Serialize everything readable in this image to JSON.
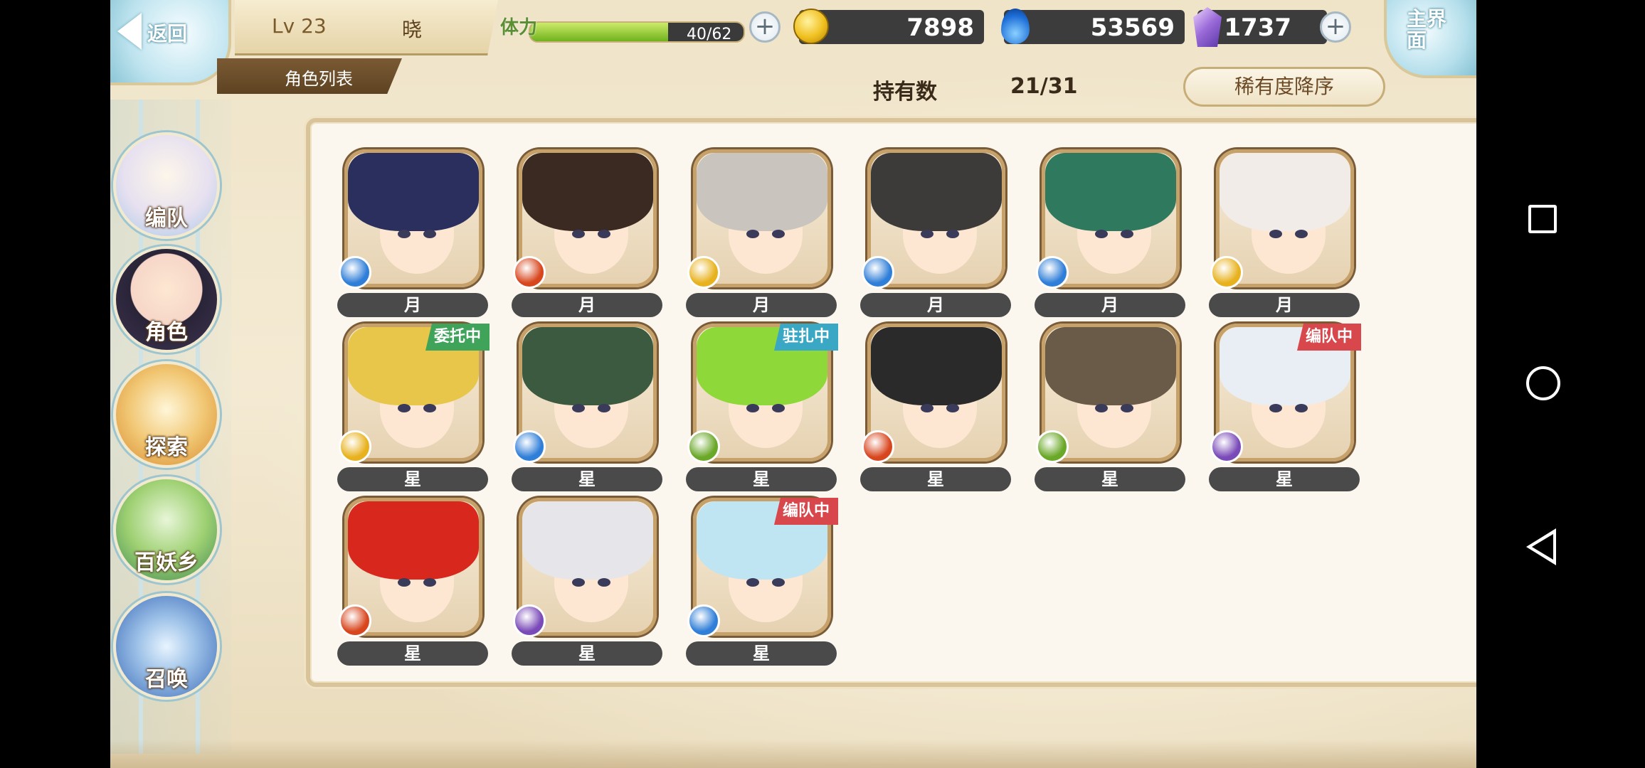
{
  "header": {
    "back_label": "返回",
    "level": "Lv 23",
    "player_name": "晓",
    "page_title": "角色列表",
    "main_label": "主界面",
    "stamina_label": "体力",
    "stamina_text": "40/62",
    "stamina_fraction": 0.645,
    "coins": "7898",
    "spirit": "53569",
    "gems": "1737"
  },
  "roster": {
    "owned_label": "持有数",
    "owned_count": "21/31",
    "sort_label": "稀有度降序"
  },
  "nav": [
    {
      "label": "编队",
      "icon": "team-formation-icon"
    },
    {
      "label": "角色",
      "icon": "character-icon"
    },
    {
      "label": "探索",
      "icon": "explore-icon"
    },
    {
      "label": "百妖乡",
      "icon": "village-icon"
    },
    {
      "label": "召唤",
      "icon": "summon-icon"
    }
  ],
  "characters": [
    {
      "grade": "月",
      "tag": "",
      "element": "water",
      "hair": "#2a2f5e"
    },
    {
      "grade": "月",
      "tag": "",
      "element": "fire",
      "hair": "#3a2a22"
    },
    {
      "grade": "月",
      "tag": "",
      "element": "light",
      "hair": "#c9c4bd"
    },
    {
      "grade": "月",
      "tag": "",
      "element": "water",
      "hair": "#3d3a3a"
    },
    {
      "grade": "月",
      "tag": "",
      "element": "water",
      "hair": "#2f7a5e"
    },
    {
      "grade": "月",
      "tag": "",
      "element": "light",
      "hair": "#f2ece8"
    },
    {
      "grade": "星",
      "tag": "委托中",
      "element": "light",
      "hair": "#e8c64a"
    },
    {
      "grade": "星",
      "tag": "",
      "element": "water",
      "hair": "#3c5a40"
    },
    {
      "grade": "星",
      "tag": "驻扎中",
      "element": "wind",
      "hair": "#8ed83a"
    },
    {
      "grade": "星",
      "tag": "",
      "element": "fire",
      "hair": "#2a2a2a"
    },
    {
      "grade": "星",
      "tag": "",
      "element": "wind",
      "hair": "#6a5a48"
    },
    {
      "grade": "星",
      "tag": "编队中",
      "element": "dark",
      "hair": "#e8eef4"
    },
    {
      "grade": "星",
      "tag": "",
      "element": "fire",
      "hair": "#d8281e"
    },
    {
      "grade": "星",
      "tag": "",
      "element": "dark",
      "hair": "#e6e6ea"
    },
    {
      "grade": "星",
      "tag": "编队中",
      "element": "water",
      "hair": "#bfe4f2"
    }
  ],
  "colors": {
    "element_water": "#2f7ed8",
    "element_fire": "#d8461e",
    "element_light": "#e8b21e",
    "element_wind": "#6aa828",
    "element_dark": "#7a4ab8",
    "tag_commission": "#3fa35a",
    "tag_station": "#3aa7c4",
    "tag_team": "#d8474b"
  }
}
